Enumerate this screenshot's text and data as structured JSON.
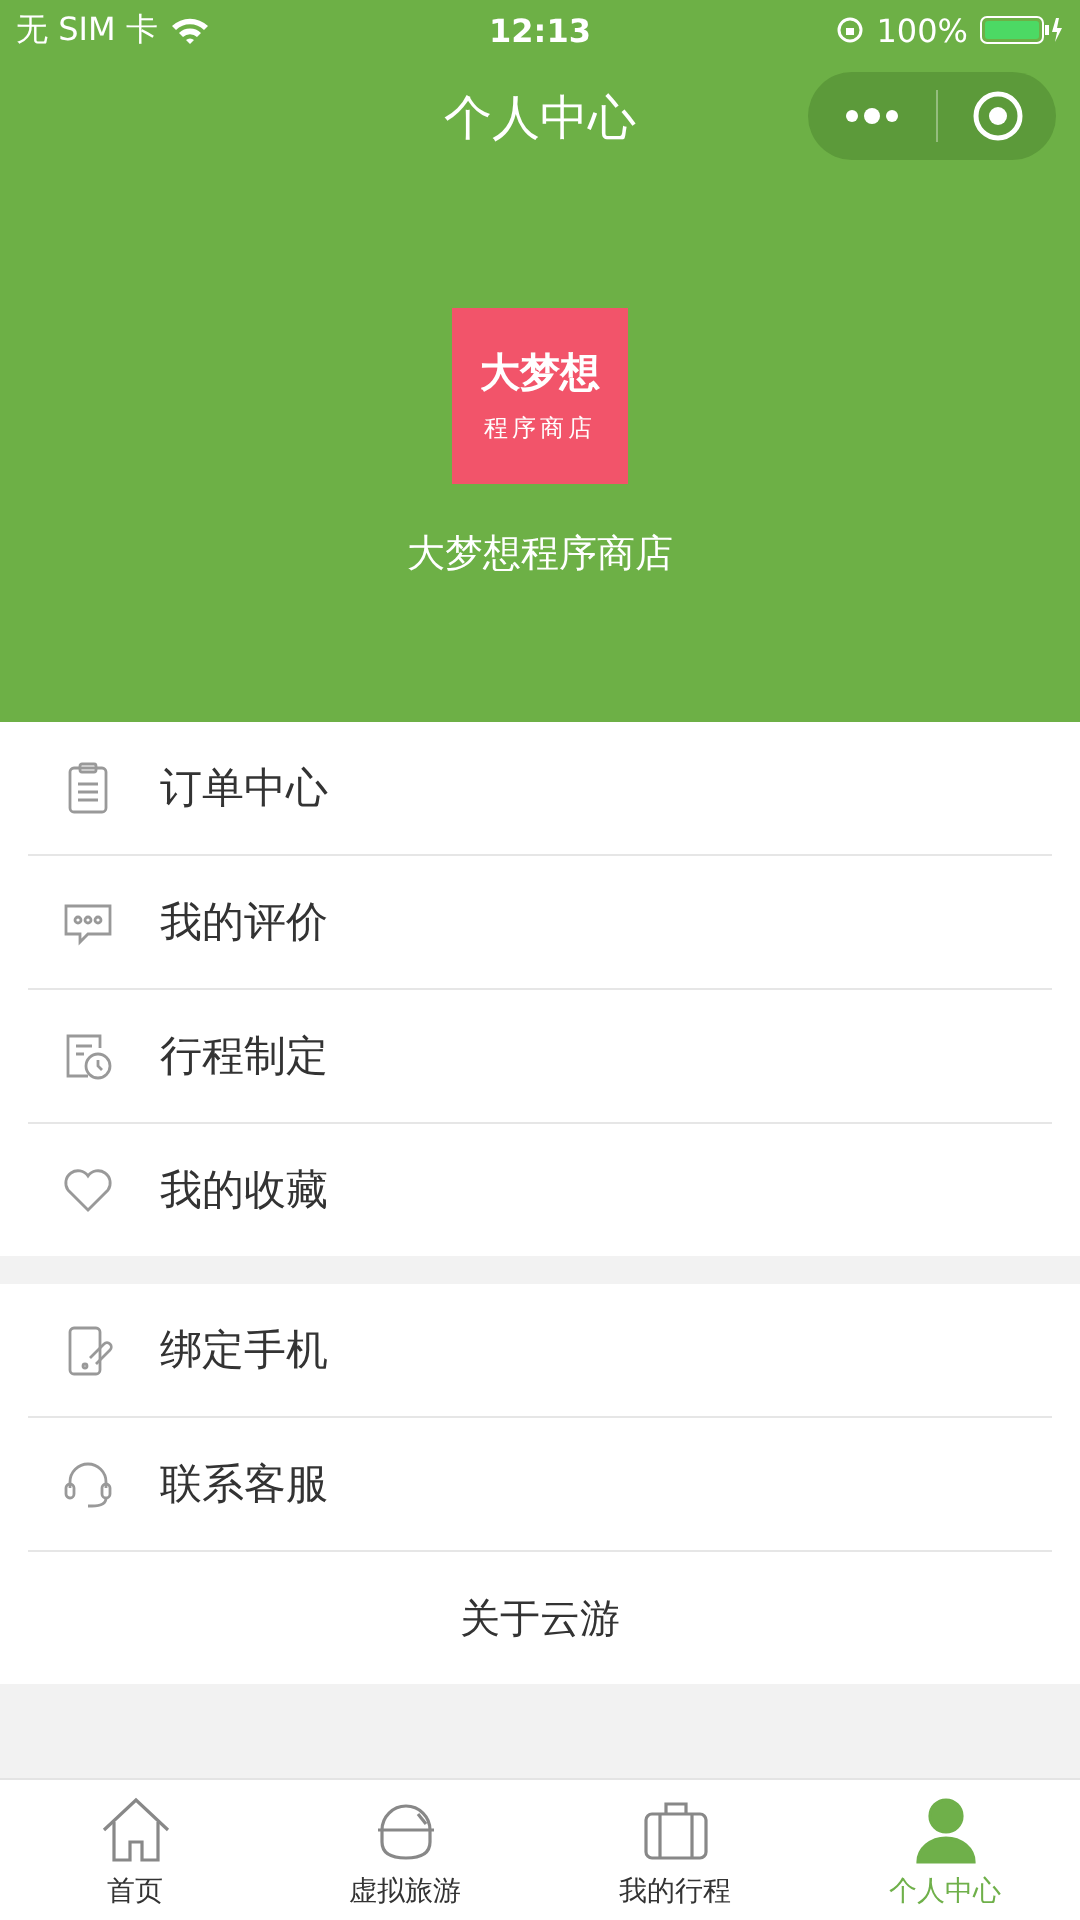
{
  "status_bar": {
    "carrier": "无 SIM 卡",
    "time": "12:13",
    "battery": "100%"
  },
  "nav_bar": {
    "title": "个人中心"
  },
  "profile": {
    "logo_title": "大梦想",
    "logo_subtitle": "程序商店",
    "name": "大梦想程序商店"
  },
  "sections": [
    {
      "items": [
        {
          "kind": "row",
          "label": "订单中心"
        },
        {
          "kind": "row",
          "label": "我的评价"
        },
        {
          "kind": "row",
          "label": "行程制定"
        },
        {
          "kind": "row",
          "label": "我的收藏"
        }
      ]
    },
    {
      "items": [
        {
          "kind": "row",
          "label": "绑定手机"
        },
        {
          "kind": "row",
          "label": "联系客服"
        },
        {
          "kind": "center",
          "label": "关于云游"
        }
      ]
    }
  ],
  "tab_bar": [
    {
      "label": "首页",
      "selected": false
    },
    {
      "label": "虚拟旅游",
      "selected": false
    },
    {
      "label": "我的行程",
      "selected": false
    },
    {
      "label": "个人中心",
      "selected": true
    }
  ]
}
